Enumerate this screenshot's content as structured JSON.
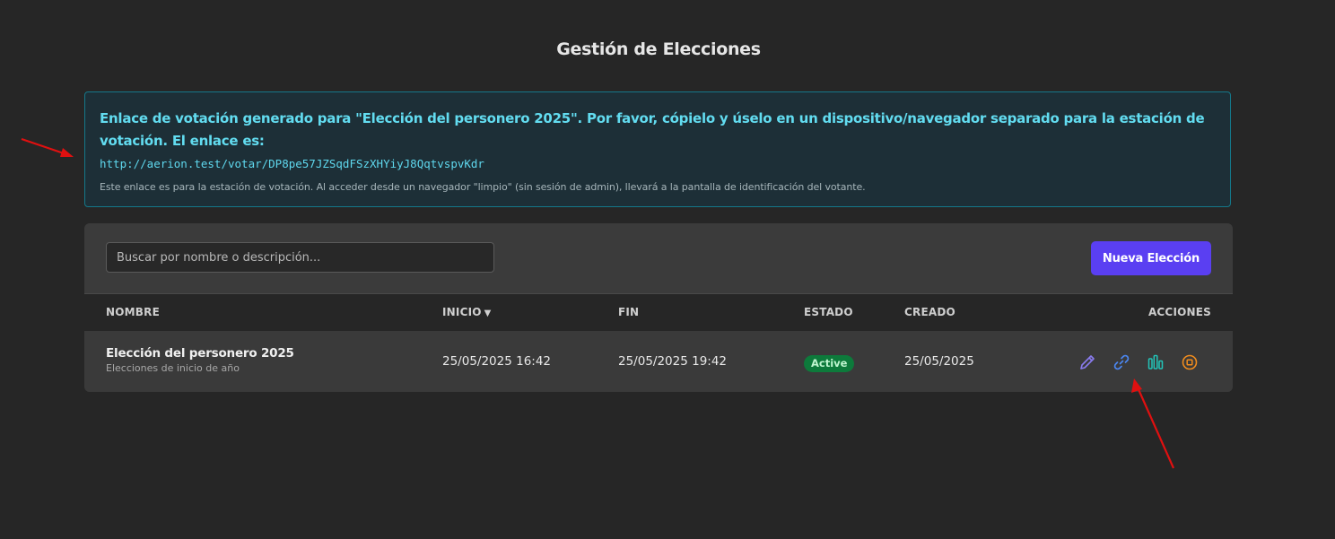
{
  "page": {
    "title": "Gestión de Elecciones"
  },
  "alert": {
    "message": "Enlace de votación generado para \"Elección del personero 2025\". Por favor, cópielo y úselo en un dispositivo/navegador separado para la estación de votación. El enlace es:",
    "link": "http://aerion.test/votar/DP8pe57JZSqdFSzXHYiyJ8QqtvspvKdr",
    "note": "Este enlace es para la estación de votación. Al acceder desde un navegador \"limpio\" (sin sesión de admin), llevará a la pantalla de identificación del votante.",
    "colors": {
      "border": "#14788a",
      "background": "#1d2f37",
      "text": "#62dcf0"
    }
  },
  "toolbar": {
    "search_placeholder": "Buscar por nombre o descripción...",
    "search_value": "",
    "new_button_label": "Nueva Elección",
    "accent_color": "#5a3ff2"
  },
  "table": {
    "headers": {
      "name": "NOMBRE",
      "start": "INICIO",
      "start_sort_icon": "▼",
      "end": "FIN",
      "status": "ESTADO",
      "created": "CREADO",
      "actions": "ACCIONES"
    },
    "rows": [
      {
        "name": "Elección del personero 2025",
        "description": "Elecciones de inicio de año",
        "start": "25/05/2025 16:42",
        "end": "25/05/2025 19:42",
        "status": "Active",
        "created": "25/05/2025",
        "actions": [
          "pencil-icon",
          "link-icon",
          "results-chart-icon",
          "stop-circle-icon"
        ]
      }
    ]
  },
  "annotations": {
    "arrow_color": "#e01010"
  }
}
